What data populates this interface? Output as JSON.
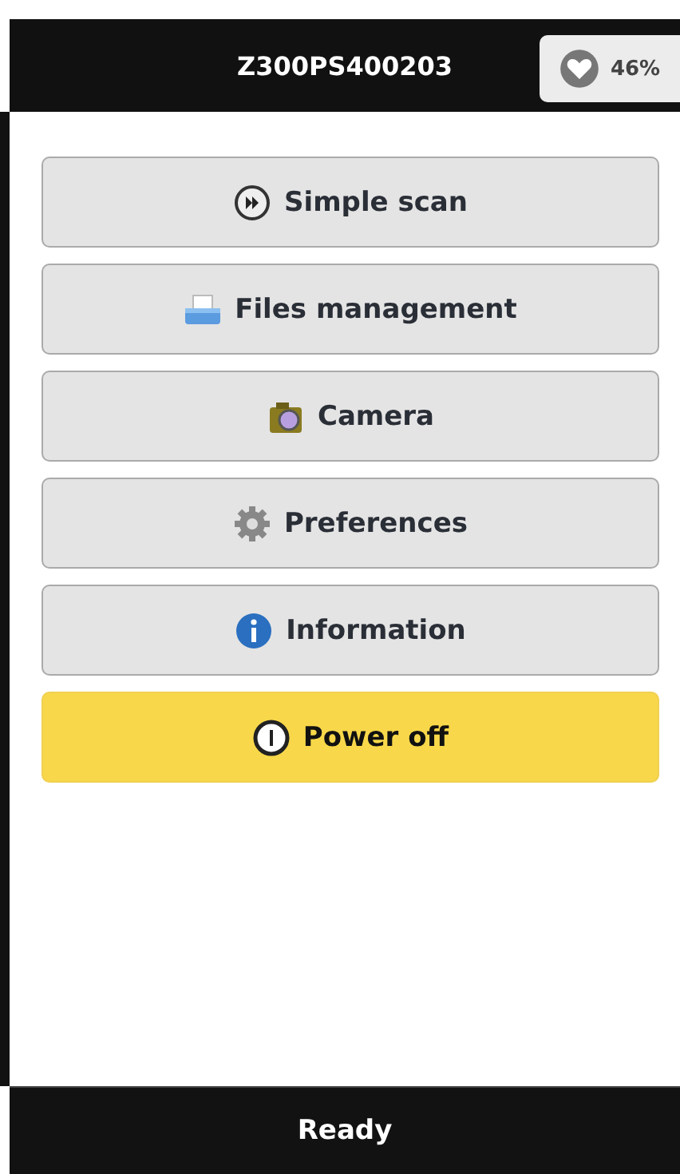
{
  "header": {
    "title": "Z300PS400203",
    "battery": "46%"
  },
  "menu": [
    {
      "label": "Simple scan",
      "kind": "scan"
    },
    {
      "label": "Files management",
      "kind": "files"
    },
    {
      "label": "Camera",
      "kind": "camera"
    },
    {
      "label": "Preferences",
      "kind": "preferences"
    },
    {
      "label": "Information",
      "kind": "information"
    },
    {
      "label": "Power off",
      "kind": "power"
    }
  ],
  "status_bar": "Ready"
}
